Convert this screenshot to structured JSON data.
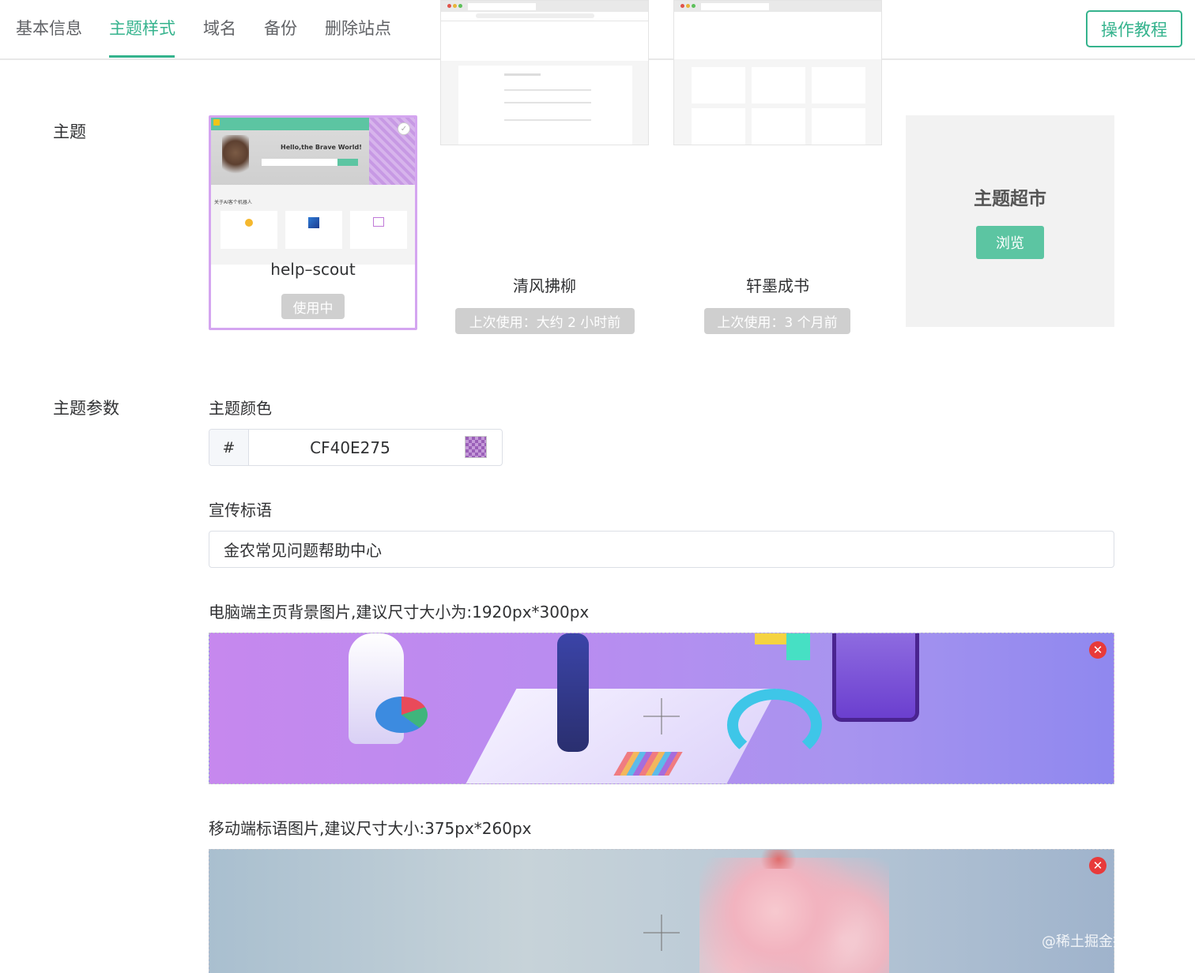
{
  "tabs": [
    {
      "label": "基本信息",
      "active": false
    },
    {
      "label": "主题样式",
      "active": true
    },
    {
      "label": "域名",
      "active": false
    },
    {
      "label": "备份",
      "active": false
    },
    {
      "label": "删除站点",
      "active": false
    }
  ],
  "tutorial_button": "操作教程",
  "theme_section": {
    "label": "主题",
    "cards": [
      {
        "name": "help–scout",
        "status": "使用中",
        "selected": true,
        "preview_title": "Hello,the Brave World!",
        "preview_section": "关于AI客个机器人"
      },
      {
        "name": "清风拂柳",
        "status": "上次使用：大约 2 小时前",
        "selected": false
      },
      {
        "name": "轩墨成书",
        "status": "上次使用：3 个月前",
        "selected": false
      }
    ],
    "market": {
      "title": "主题超市",
      "button": "浏览"
    }
  },
  "params_section": {
    "label": "主题参数",
    "color": {
      "label": "主题颜色",
      "prefix": "#",
      "value": "CF40E275"
    },
    "slogan": {
      "label": "宣传标语",
      "value": "金农常见问题帮助中心"
    },
    "pc_banner": {
      "label": "电脑端主页背景图片,建议尺寸大小为:1920px*300px"
    },
    "mobile_banner": {
      "label": "移动端标语图片,建议尺寸大小:375px*260px"
    }
  },
  "watermark": "@稀土掘金技术社区",
  "colors": {
    "accent": "#35b38d",
    "button_green": "#5cc5a2",
    "selected_border": "#d4a5f0",
    "delete_red": "#e83a3a"
  }
}
